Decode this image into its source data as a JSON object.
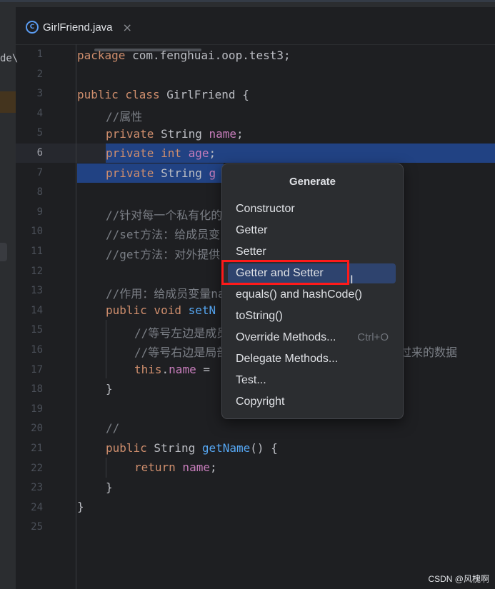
{
  "project_fragment": "de\\",
  "tab": {
    "icon": "java-class-icon",
    "title": "GirlFriend.java",
    "close": "×"
  },
  "line_numbers": [
    "1",
    "2",
    "3",
    "4",
    "5",
    "6",
    "7",
    "8",
    "9",
    "10",
    "11",
    "12",
    "13",
    "14",
    "15",
    "16",
    "17",
    "18",
    "19",
    "20",
    "21",
    "22",
    "23",
    "24",
    "25"
  ],
  "current_line": 6,
  "code": {
    "l1_kw": "package",
    "l1_rest": " com.fenghuai.oop.test3;",
    "l3_kw": "public class",
    "l3_rest": " GirlFriend {",
    "l4": "//属性",
    "l5_kw": "private",
    "l5_type": " String ",
    "l5_field": "name",
    "l5_end": ";",
    "l6_kw": "private int",
    "l6_field": " age",
    "l6_end": ";",
    "l7_kw": "private",
    "l7_type": " String ",
    "l7_field": "g",
    "l9": "//针对每一个私有化的",
    "l10": "//set方法：给成员变",
    "l11": "//get方法：对外提供",
    "l13": "//作用：给成员变量na",
    "l14_kw": "public void",
    "l14_rest": " setN",
    "l15": "//等号左边是成员",
    "l16": "//等号右边是局部",
    "l16_tail": "过来的数据",
    "l17_kw": "this",
    "l17_dot": ".",
    "l17_field": "name",
    "l17_rest": " =",
    "l18": "}",
    "l20": "//",
    "l21_kw": "public",
    "l21_type": " String ",
    "l21_fn": "getName",
    "l21_rest": "() {",
    "l22_kw": "return",
    "l22_field": " name",
    "l22_end": ";",
    "l23": "}",
    "l24": "}"
  },
  "popup": {
    "title": "Generate",
    "items": [
      {
        "label": "Constructor",
        "shortcut": ""
      },
      {
        "label": "Getter",
        "shortcut": ""
      },
      {
        "label": "Setter",
        "shortcut": ""
      },
      {
        "label": "Getter and Setter",
        "shortcut": ""
      },
      {
        "label": "equals() and hashCode()",
        "shortcut": ""
      },
      {
        "label": "toString()",
        "shortcut": ""
      },
      {
        "label": "Override Methods...",
        "shortcut": "Ctrl+O"
      },
      {
        "label": "Delegate Methods...",
        "shortcut": ""
      },
      {
        "label": "Test...",
        "shortcut": ""
      },
      {
        "label": "Copyright",
        "shortcut": ""
      }
    ],
    "selected_index": 3
  },
  "cursor_glyph": "I",
  "watermark": "CSDN @风槐啊"
}
